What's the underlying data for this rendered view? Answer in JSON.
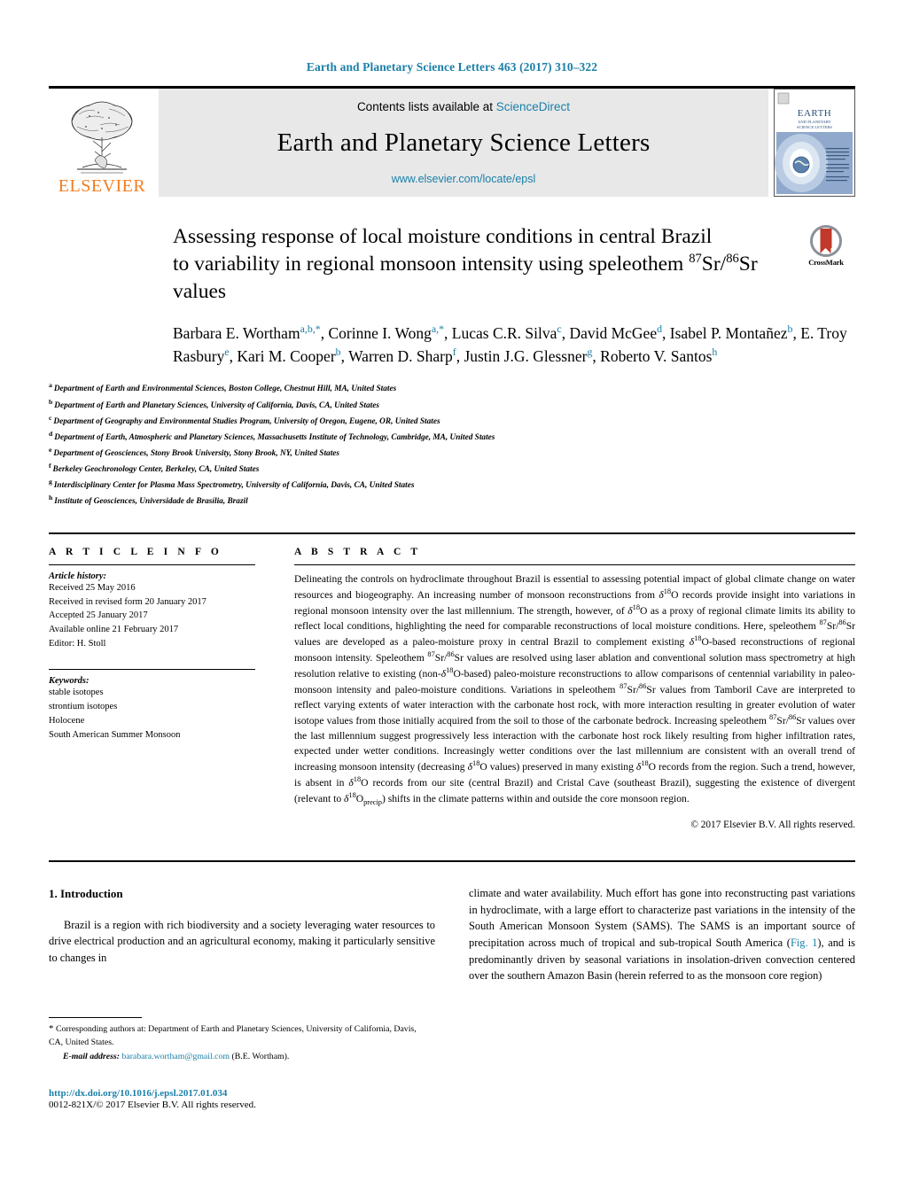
{
  "running_head": "Earth and Planetary Science Letters 463 (2017) 310–322",
  "masthead": {
    "contents_prefix": "Contents lists available at ",
    "sciencedirect": "ScienceDirect",
    "journal_name": "Earth and Planetary Science Letters",
    "journal_url": "www.elsevier.com/locate/epsl",
    "publisher_name": "ELSEVIER",
    "cover_title": "EARTH",
    "cover_subtitle": "AND PLANETARY SCIENCE LETTERS"
  },
  "article": {
    "title_line1": "Assessing response of local moisture conditions in central Brazil",
    "title_line2_pre": "to variability in regional monsoon intensity using speleothem ",
    "title_sup1": "87",
    "title_mid1": "Sr/",
    "title_sup2": "86",
    "title_mid2": "Sr",
    "title_line3": "values",
    "crossmark_label": "CrossMark"
  },
  "authors": [
    {
      "name": "Barbara E. Wortham",
      "sup": "a,b,*"
    },
    {
      "name": "Corinne I. Wong",
      "sup": "a,*"
    },
    {
      "name": "Lucas C.R. Silva",
      "sup": "c"
    },
    {
      "name": "David McGee",
      "sup": "d"
    },
    {
      "name": "Isabel P. Montañez",
      "sup": "b"
    },
    {
      "name": "E. Troy Rasbury",
      "sup": "e"
    },
    {
      "name": "Kari M. Cooper",
      "sup": "b"
    },
    {
      "name": "Warren D. Sharp",
      "sup": "f"
    },
    {
      "name": "Justin J.G. Glessner",
      "sup": "g"
    },
    {
      "name": "Roberto V. Santos",
      "sup": "h"
    }
  ],
  "affiliations": [
    {
      "mark": "a",
      "text": "Department of Earth and Environmental Sciences, Boston College, Chestnut Hill, MA, United States"
    },
    {
      "mark": "b",
      "text": "Department of Earth and Planetary Sciences, University of California, Davis, CA, United States"
    },
    {
      "mark": "c",
      "text": "Department of Geography and Environmental Studies Program, University of Oregon, Eugene, OR, United States"
    },
    {
      "mark": "d",
      "text": "Department of Earth, Atmospheric and Planetary Sciences, Massachusetts Institute of Technology, Cambridge, MA, United States"
    },
    {
      "mark": "e",
      "text": "Department of Geosciences, Stony Brook University, Stony Brook, NY, United States"
    },
    {
      "mark": "f",
      "text": "Berkeley Geochronology Center, Berkeley, CA, United States"
    },
    {
      "mark": "g",
      "text": "Interdisciplinary Center for Plasma Mass Spectrometry, University of California, Davis, CA, United States"
    },
    {
      "mark": "h",
      "text": "Institute of Geosciences, Universidade de Brasília, Brazil"
    }
  ],
  "article_info": {
    "heading": "A R T I C L E   I N F O",
    "history_label": "Article history:",
    "history": [
      "Received 25 May 2016",
      "Received in revised form 20 January 2017",
      "Accepted 25 January 2017",
      "Available online 21 February 2017",
      "Editor: H. Stoll"
    ],
    "keywords_label": "Keywords:",
    "keywords": [
      "stable isotopes",
      "strontium isotopes",
      "Holocene",
      "South American Summer Monsoon"
    ]
  },
  "abstract": {
    "heading": "A B S T R A C T",
    "copyright": "© 2017 Elsevier B.V. All rights reserved."
  },
  "introduction": {
    "heading": "1. Introduction",
    "left_paragraph": "Brazil is a region with rich biodiversity and a society leveraging water resources to drive electrical production and an agricultural economy, making it particularly sensitive to changes in",
    "right_p1": "climate and water availability. Much effort has gone into reconstructing past variations in hydroclimate, with a large effort to characterize past variations in the intensity of the South American Monsoon System (SAMS). The SAMS is an important source of precipitation across much of tropical and sub-tropical South America (",
    "right_fig_link": "Fig. 1",
    "right_p2": "), and is predominantly driven by seasonal variations in insolation-driven convection centered over the southern Amazon Basin (herein referred to as the monsoon core region)"
  },
  "footnotes": {
    "corresponding": "Corresponding authors at: Department of Earth and Planetary Sciences, University of California, Davis, CA, United States.",
    "email_label": "E-mail address:",
    "email": "barabara.wortham@gmail.com",
    "email_owner": "(B.E. Wortham).",
    "doi": "http://dx.doi.org/10.1016/j.epsl.2017.01.034",
    "issn": "0012-821X/© 2017 Elsevier B.V. All rights reserved."
  },
  "colors": {
    "link_blue": "#1a7fa8",
    "elsevier_orange": "#f47c20",
    "masthead_grey": "#e8e8e8"
  }
}
